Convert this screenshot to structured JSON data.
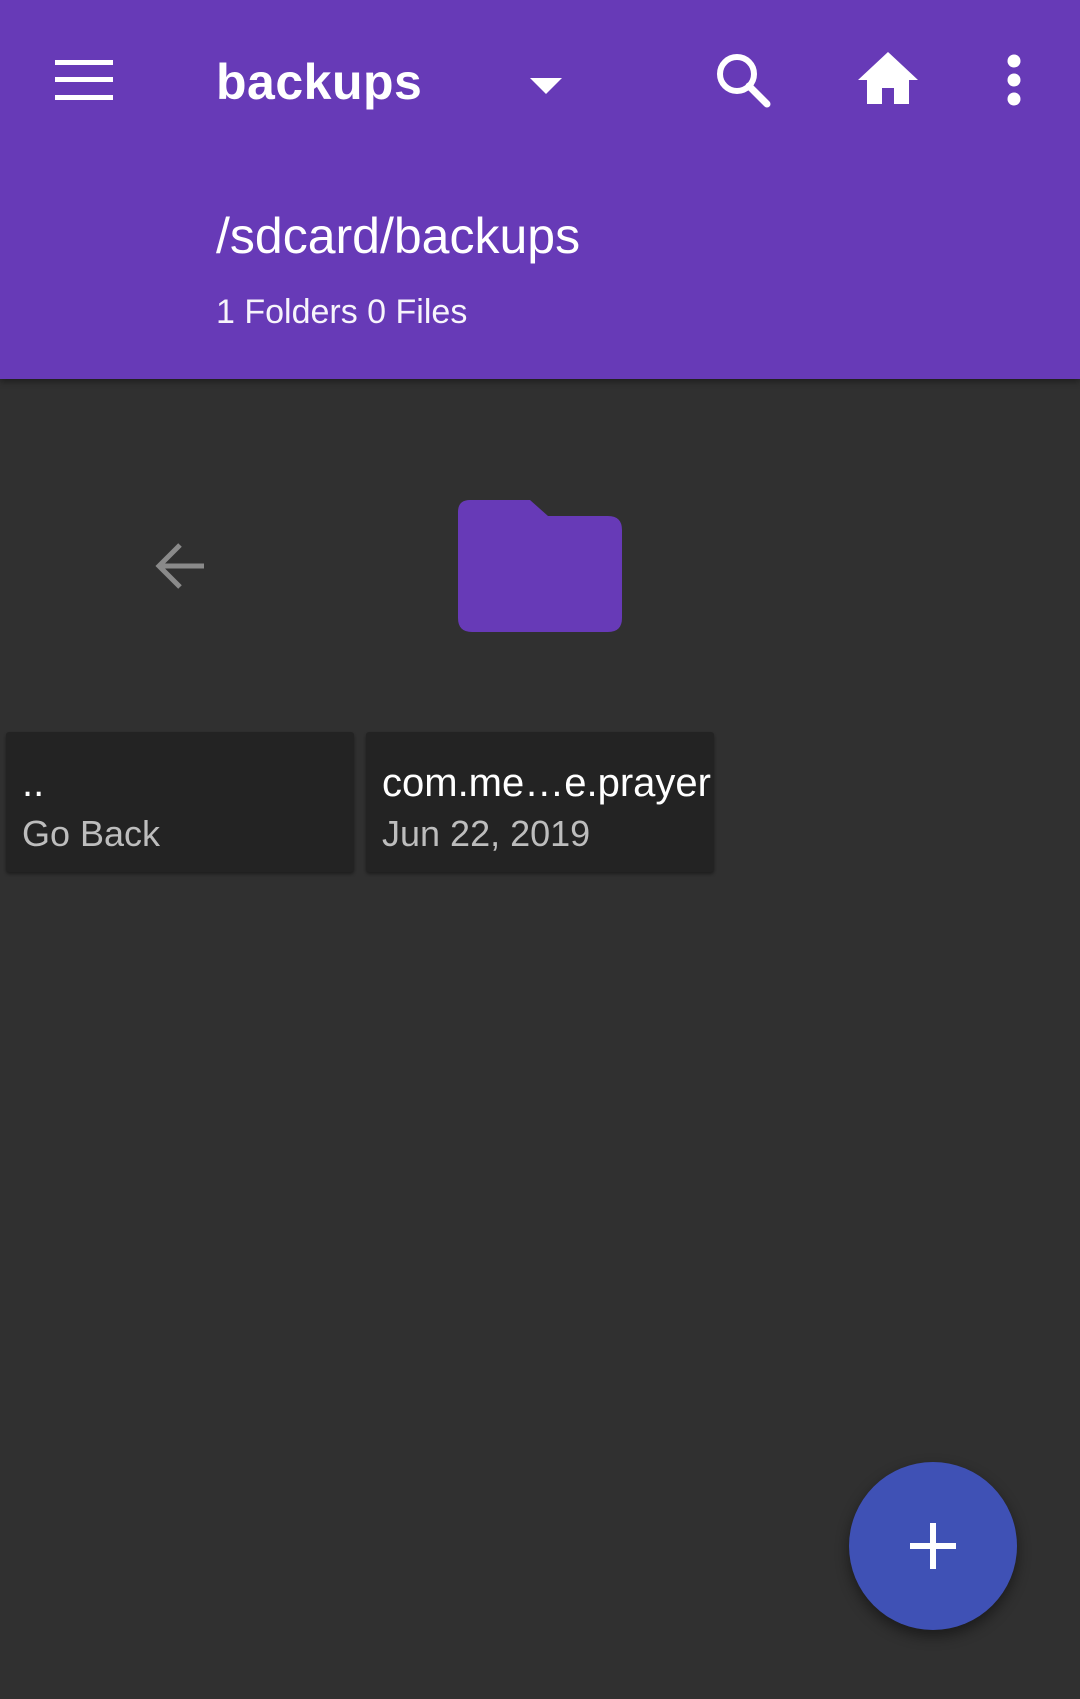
{
  "appbar": {
    "title": "backups",
    "path": "/sdcard/backups",
    "counts": "1 Folders 0 Files",
    "icons": {
      "menu": "menu-icon",
      "dropdown": "arrow-drop-down-icon",
      "search": "search-icon",
      "home": "home-icon",
      "more": "more-vert-icon"
    }
  },
  "items": [
    {
      "name": "..",
      "subtitle": "Go Back",
      "icon": "arrow-back-icon"
    },
    {
      "name": "com.me…e.prayer",
      "subtitle": "Jun 22, 2019",
      "icon": "folder-icon"
    }
  ],
  "fab": {
    "icon": "add-icon"
  },
  "colors": {
    "primary": "#673ab7",
    "background": "#303030",
    "card": "#232323",
    "fab": "#3f51b5",
    "back_arrow": "#8a8a8a"
  }
}
